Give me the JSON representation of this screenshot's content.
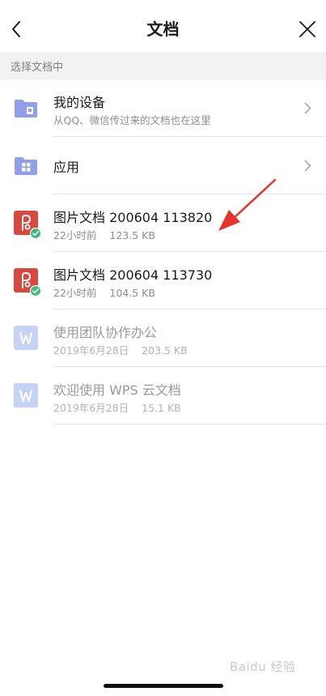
{
  "nav": {
    "title": "文档"
  },
  "section": {
    "header": "选择文档中"
  },
  "items": [
    {
      "title": "我的设备",
      "subtitle": "从QQ、微信传过来的文档也在这里",
      "icon": "device-folder-icon",
      "kind": "folder"
    },
    {
      "title": "应用",
      "icon": "apps-folder-icon",
      "kind": "folder"
    },
    {
      "title": "图片文档 200604 113820",
      "time": "22小时前",
      "size": "123.5 KB",
      "icon": "pdf-file-icon",
      "kind": "file",
      "synced": true
    },
    {
      "title": "图片文档 200604 113730",
      "time": "22小时前",
      "size": "104.5 KB",
      "icon": "pdf-file-icon",
      "kind": "file",
      "synced": true
    },
    {
      "title": "使用团队协作办公",
      "time": "2019年6月28日",
      "size": "203.5 KB",
      "icon": "word-file-icon",
      "kind": "file",
      "disabled": true
    },
    {
      "title": "欢迎使用 WPS 云文档",
      "time": "2019年6月28日",
      "size": "15.1 KB",
      "icon": "word-file-icon",
      "kind": "file",
      "disabled": true
    }
  ],
  "watermark": {
    "text": "Baidu 经验"
  },
  "colors": {
    "folder": "#8fa0e8",
    "pdf": "#d9473f",
    "word_disabled": "#c7d3f5",
    "synced_badge": "#3fb87a",
    "annotation_arrow": "#e8322e"
  }
}
